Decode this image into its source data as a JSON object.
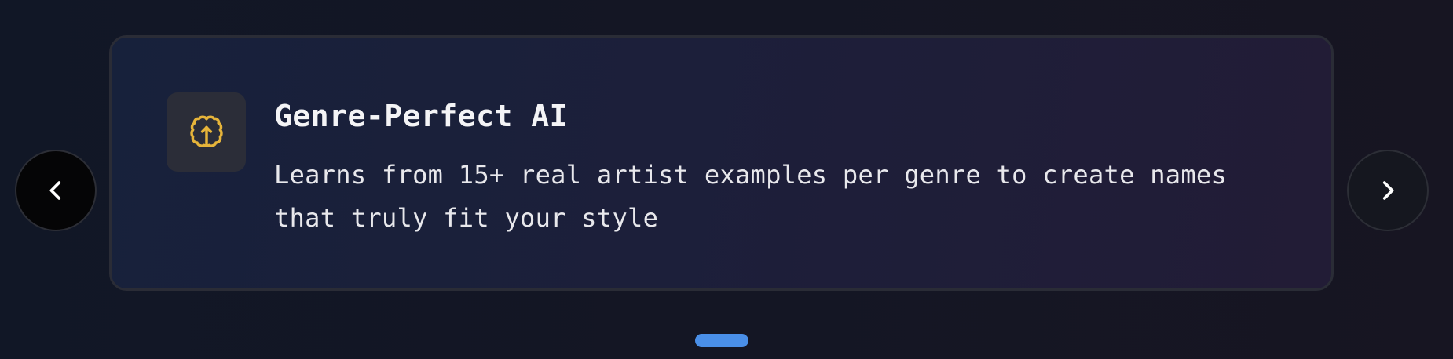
{
  "feature": {
    "title": "Genre-Perfect AI",
    "description": "Learns from 15+ real artist examples per genre to create names that truly fit your style",
    "icon": "brain-icon"
  },
  "carousel": {
    "prev_icon": "chevron-left-icon",
    "next_icon": "chevron-right-icon",
    "active_index": 0,
    "slide_count": 1
  },
  "colors": {
    "accent_icon": "#e6b43a",
    "indicator": "#4a8fe8"
  }
}
